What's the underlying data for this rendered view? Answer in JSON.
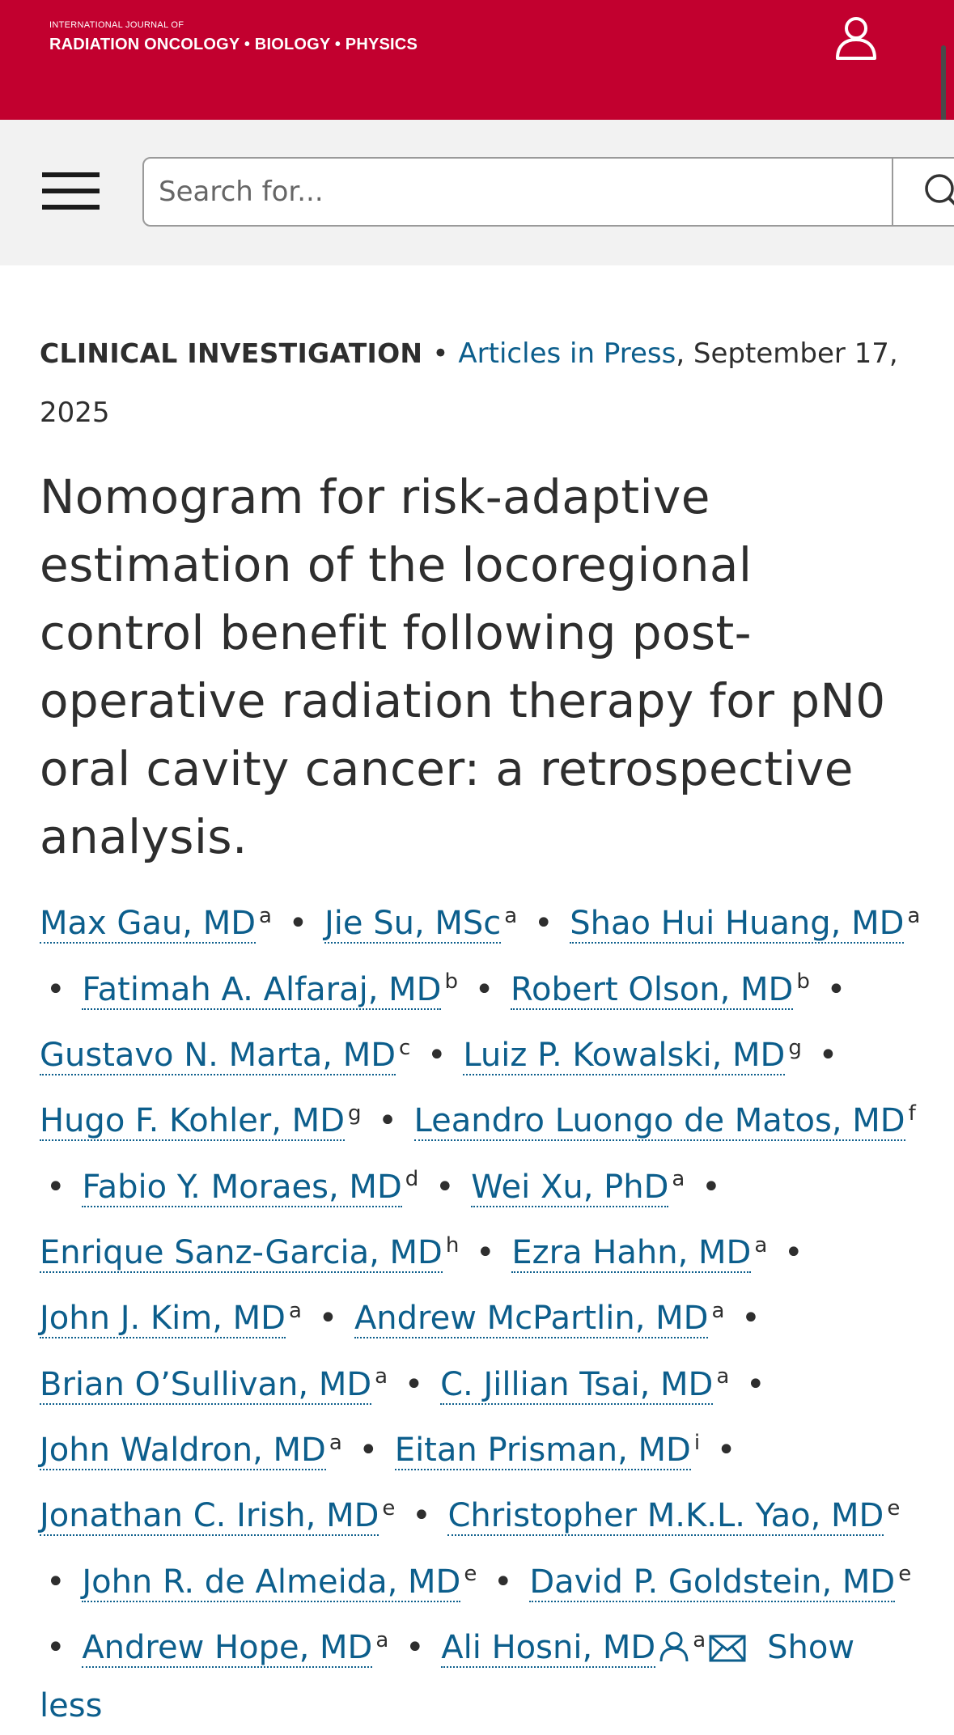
{
  "header": {
    "journal_line1": "INTERNATIONAL JOURNAL OF",
    "journal_line2": "RADIATION ONCOLOGY • BIOLOGY • PHYSICS",
    "brand_color": "#c2002f",
    "user_icon": "user-icon"
  },
  "search": {
    "placeholder": "Search for...",
    "menu_icon": "hamburger-menu-icon",
    "submit_icon": "search-icon"
  },
  "article": {
    "section": "CLINICAL INVESTIGATION",
    "separator": "•",
    "status_link": "Articles in Press",
    "date": ", September 17, 2025",
    "title": "Nomogram for risk-adaptive estimation of the locoregional control benefit following post-operative radiation therapy for pN0 oral cavity cancer: a retrospective analysis.",
    "link_color": "#0c5e8c"
  },
  "authors": [
    {
      "name": "Max Gau, MD",
      "aff": "a"
    },
    {
      "name": "Jie Su, MSc",
      "aff": "a"
    },
    {
      "name": "Shao Hui Huang, MD",
      "aff": "a"
    },
    {
      "name": "Fatimah A. Alfaraj, MD",
      "aff": "b"
    },
    {
      "name": "Robert Olson, MD",
      "aff": "b"
    },
    {
      "name": "Gustavo N. Marta, MD",
      "aff": "c"
    },
    {
      "name": "Luiz P. Kowalski, MD",
      "aff": "g"
    },
    {
      "name": "Hugo F. Kohler, MD",
      "aff": "g"
    },
    {
      "name": "Leandro Luongo de Matos, MD",
      "aff": "f"
    },
    {
      "name": "Fabio Y. Moraes, MD",
      "aff": "d"
    },
    {
      "name": "Wei Xu, PhD",
      "aff": "a"
    },
    {
      "name": "Enrique Sanz-Garcia, MD",
      "aff": "h"
    },
    {
      "name": "Ezra Hahn, MD",
      "aff": "a"
    },
    {
      "name": "John J. Kim, MD",
      "aff": "a"
    },
    {
      "name": "Andrew McPartlin, MD",
      "aff": "a"
    },
    {
      "name": "Brian O’Sullivan, MD",
      "aff": "a"
    },
    {
      "name": "C. Jillian Tsai, MD",
      "aff": "a"
    },
    {
      "name": "John Waldron, MD",
      "aff": "a"
    },
    {
      "name": "Eitan Prisman, MD",
      "aff": "i"
    },
    {
      "name": "Jonathan C. Irish, MD",
      "aff": "e"
    },
    {
      "name": "Christopher M.K.L. Yao, MD",
      "aff": "e"
    },
    {
      "name": "John R. de Almeida, MD",
      "aff": "e"
    },
    {
      "name": "David P. Goldstein, MD",
      "aff": "e"
    },
    {
      "name": "Andrew Hope, MD",
      "aff": "a"
    },
    {
      "name": "Ali Hosni, MD",
      "aff": "a",
      "icons": [
        "person-icon",
        "envelope-icon"
      ]
    }
  ],
  "show_less": "Show less"
}
